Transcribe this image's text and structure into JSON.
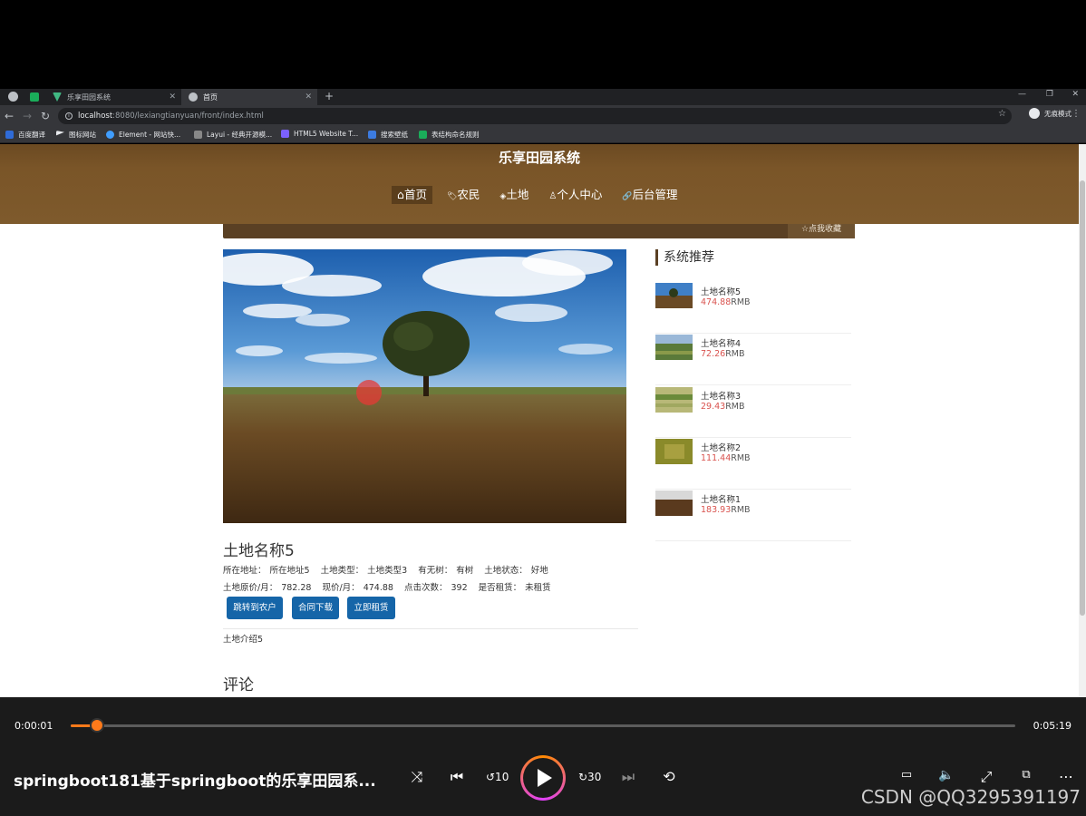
{
  "browser": {
    "tabs": [
      {
        "title": "乐享田园系统"
      },
      {
        "title": "首页"
      }
    ],
    "url_host": "localhost",
    "url_rest": ":8080/lexiangtianyuan/front/index.html",
    "profile_label": "无痕模式",
    "bookmarks": [
      "百度翻译",
      "图标网站",
      "Element - 网站快...",
      "Layui - 经典开源模...",
      "HTML5 Website T...",
      "搜索壁纸",
      "表结构命名规则"
    ]
  },
  "site": {
    "title": "乐享田园系统",
    "nav": [
      {
        "icon": "⌂",
        "label": "首页",
        "active": true
      },
      {
        "icon": "🏷",
        "label": "农民"
      },
      {
        "icon": "◈",
        "label": "土地"
      },
      {
        "icon": "♙",
        "label": "个人中心"
      },
      {
        "icon": "🔗",
        "label": "后台管理"
      }
    ],
    "favorite_label": "☆点我收藏"
  },
  "detail": {
    "title": "土地名称5",
    "fields1": [
      {
        "label": "所在地址：",
        "value": "所在地址5"
      },
      {
        "label": "土地类型：",
        "value": "土地类型3"
      },
      {
        "label": "有无树：",
        "value": "有树"
      },
      {
        "label": "土地状态：",
        "value": "好地"
      }
    ],
    "fields2": [
      {
        "label": "土地原价/月：",
        "value": "782.28"
      },
      {
        "label": "现价/月：",
        "value": "474.88"
      },
      {
        "label": "点击次数：",
        "value": "392"
      },
      {
        "label": "是否租赁：",
        "value": "未租赁"
      }
    ],
    "buttons": [
      "跳转到农户",
      "合同下载",
      "立即租赁"
    ],
    "intro": "土地介绍5",
    "comments_heading": "评论"
  },
  "recommend": {
    "heading": "系统推荐",
    "items": [
      {
        "name": "土地名称5",
        "price": "474.88",
        "unit": "RMB"
      },
      {
        "name": "土地名称4",
        "price": "72.26",
        "unit": "RMB"
      },
      {
        "name": "土地名称3",
        "price": "29.43",
        "unit": "RMB"
      },
      {
        "name": "土地名称2",
        "price": "111.44",
        "unit": "RMB"
      },
      {
        "name": "土地名称1",
        "price": "183.93",
        "unit": "RMB"
      }
    ]
  },
  "player": {
    "current_time": "0:00:01",
    "total_time": "0:05:19",
    "progress": 0.028,
    "title": "springboot181基于springboot的乐享田园系...",
    "watermark": "CSDN @QQ3295391197",
    "accent_color": "#ff7a1a"
  }
}
